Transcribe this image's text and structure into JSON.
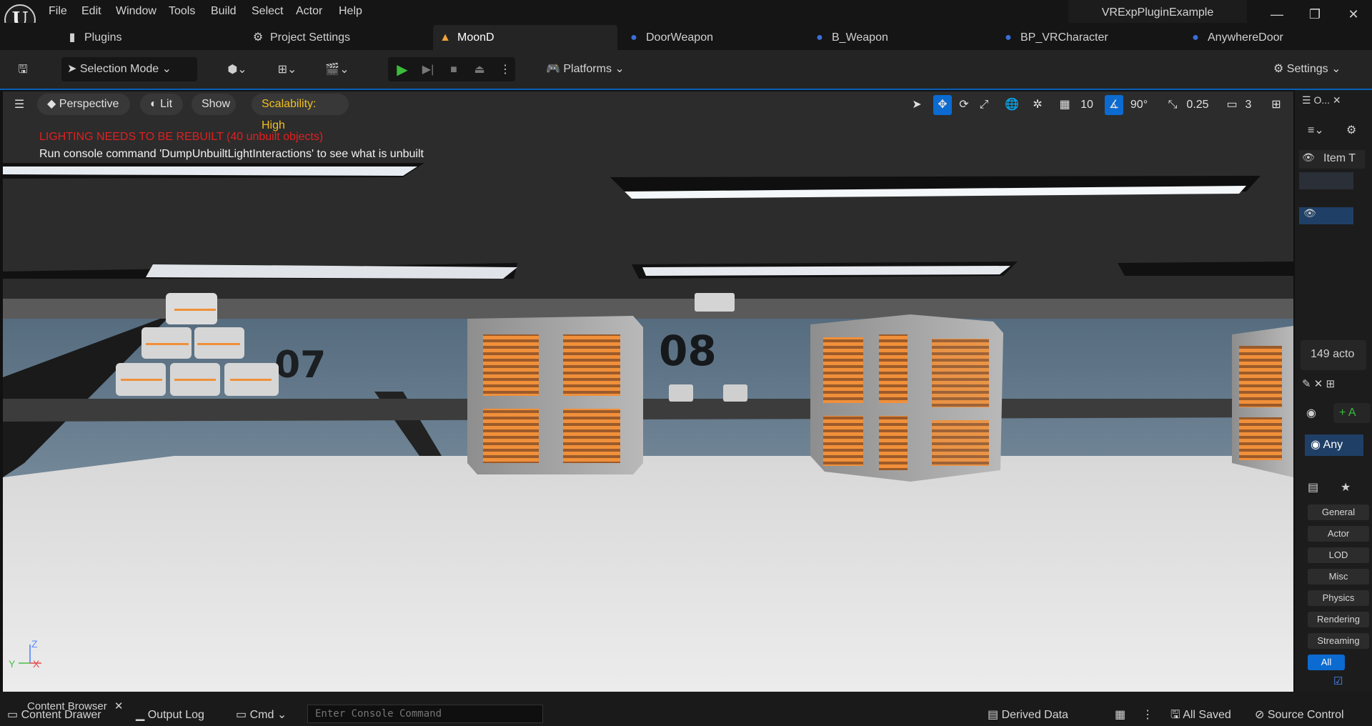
{
  "app": {
    "logo": "U",
    "project_name": "VRExpPluginExample"
  },
  "menu": [
    "File",
    "Edit",
    "Window",
    "Tools",
    "Build",
    "Select",
    "Actor",
    "Help"
  ],
  "window_controls": {
    "minimize": "—",
    "restore": "❐",
    "close": "✕"
  },
  "tabs": [
    {
      "label": "Plugins",
      "icon": "plugin-icon"
    },
    {
      "label": "Project Settings",
      "icon": "gear-icon"
    },
    {
      "label": "MoonD",
      "icon": "level-icon",
      "active": true
    },
    {
      "label": "DoorWeapon",
      "icon": "blueprint-icon"
    },
    {
      "label": "B_Weapon",
      "icon": "blueprint-icon"
    },
    {
      "label": "BP_VRCharacter",
      "icon": "blueprint-icon"
    },
    {
      "label": "AnywhereDoor",
      "icon": "blueprint-icon"
    }
  ],
  "toolbar": {
    "selection_mode": "Selection Mode",
    "platforms": "Platforms",
    "settings": "Settings"
  },
  "viewport": {
    "perspective": "Perspective",
    "lit": "Lit",
    "show": "Show",
    "scalability": "Scalability: High",
    "grid_size": "10",
    "rotation_snap": "90°",
    "scale_snap": "0.25",
    "camera_speed": "3",
    "warning_lighting": "LIGHTING NEEDS TO BE REBUILT (40 unbuilt objects)",
    "warning_console": "Run console command 'DumpUnbuiltLightInteractions' to see what is unbuilt",
    "wall_numbers": [
      "07",
      "08"
    ],
    "axis": {
      "z": "Z",
      "y": "Y",
      "x": "X"
    },
    "colors": {
      "warning": "#e02020",
      "crate_glow": "#f0903a",
      "accent": "#0b5fb5"
    }
  },
  "outliner": {
    "tab_label": "O...",
    "item_label_col": "Item T",
    "actor_count": "149 acto"
  },
  "details": {
    "add_button": "+ A",
    "selected_name": "Any",
    "filters": [
      "General",
      "Actor",
      "LOD",
      "Misc",
      "Physics",
      "Rendering",
      "Streaming",
      "All"
    ],
    "active_filter": "All"
  },
  "bottom": {
    "content_browser": "Content Browser",
    "content_drawer": "Content Drawer",
    "output_log": "Output Log",
    "cmd": "Cmd",
    "console_placeholder": "Enter Console Command",
    "derived_data": "Derived Data",
    "all_saved": "All Saved",
    "source_control": "Source Control"
  }
}
